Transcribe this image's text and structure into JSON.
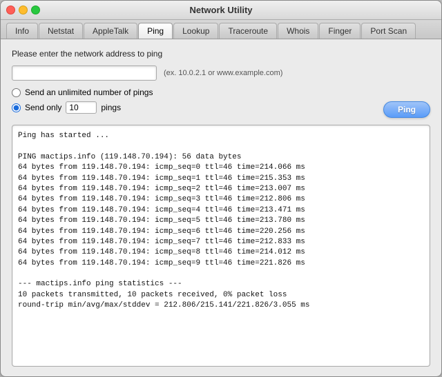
{
  "window": {
    "title": "Network Utility"
  },
  "tabs": [
    {
      "label": "Info",
      "id": "info",
      "active": false
    },
    {
      "label": "Netstat",
      "id": "netstat",
      "active": false
    },
    {
      "label": "AppleTalk",
      "id": "appletalk",
      "active": false
    },
    {
      "label": "Ping",
      "id": "ping",
      "active": true
    },
    {
      "label": "Lookup",
      "id": "lookup",
      "active": false
    },
    {
      "label": "Traceroute",
      "id": "traceroute",
      "active": false
    },
    {
      "label": "Whois",
      "id": "whois",
      "active": false
    },
    {
      "label": "Finger",
      "id": "finger",
      "active": false
    },
    {
      "label": "Port Scan",
      "id": "portscan",
      "active": false
    }
  ],
  "ping": {
    "address_label": "Please enter the network address to ping",
    "address_placeholder": "",
    "address_hint": "(ex. 10.0.2.1 or www.example.com)",
    "unlimited_label": "Send an unlimited number of pings",
    "send_only_label": "Send only",
    "pings_label": "pings",
    "ping_count": "10",
    "ping_button": "Ping",
    "output": "Ping has started ...\n\nPING mactips.info (119.148.70.194): 56 data bytes\n64 bytes from 119.148.70.194: icmp_seq=0 ttl=46 time=214.066 ms\n64 bytes from 119.148.70.194: icmp_seq=1 ttl=46 time=215.353 ms\n64 bytes from 119.148.70.194: icmp_seq=2 ttl=46 time=213.007 ms\n64 bytes from 119.148.70.194: icmp_seq=3 ttl=46 time=212.806 ms\n64 bytes from 119.148.70.194: icmp_seq=4 ttl=46 time=213.471 ms\n64 bytes from 119.148.70.194: icmp_seq=5 ttl=46 time=213.780 ms\n64 bytes from 119.148.70.194: icmp_seq=6 ttl=46 time=220.256 ms\n64 bytes from 119.148.70.194: icmp_seq=7 ttl=46 time=212.833 ms\n64 bytes from 119.148.70.194: icmp_seq=8 ttl=46 time=214.012 ms\n64 bytes from 119.148.70.194: icmp_seq=9 ttl=46 time=221.826 ms\n\n--- mactips.info ping statistics ---\n10 packets transmitted, 10 packets received, 0% packet loss\nround-trip min/avg/max/stddev = 212.806/215.141/221.826/3.055 ms"
  }
}
